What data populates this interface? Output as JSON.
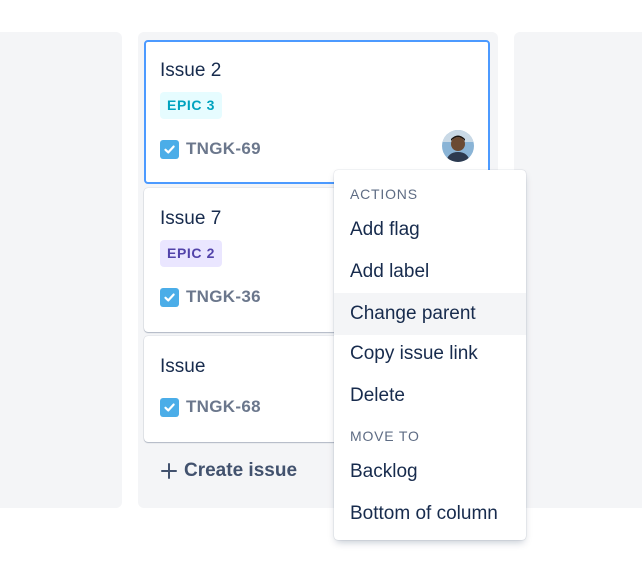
{
  "board": {
    "cards": [
      {
        "title": "Issue 2",
        "epic": "EPIC 3",
        "key": "TNGK-69",
        "has_avatar": true
      },
      {
        "title": "Issue 7",
        "epic": "EPIC 2",
        "key": "TNGK-36"
      },
      {
        "title": "Issue",
        "key": "TNGK-68"
      }
    ],
    "create_issue_label": "Create issue"
  },
  "menu": {
    "actions_heading": "ACTIONS",
    "actions": [
      "Add flag",
      "Add label",
      "Change parent",
      "Copy issue link",
      "Delete"
    ],
    "move_heading": "MOVE TO",
    "move_items": [
      "Backlog",
      "Bottom of column"
    ],
    "hovered_item": "Change parent"
  },
  "colors": {
    "selected_border": "#4c9aff",
    "epic_teal": "#00a3bf",
    "epic_purple": "#5243aa",
    "task_icon": "#4bade8"
  }
}
